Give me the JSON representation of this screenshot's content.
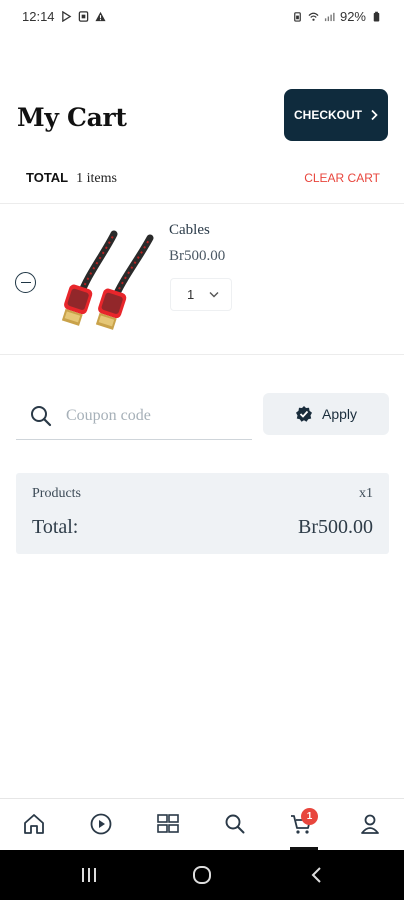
{
  "status_bar": {
    "time": "12:14",
    "battery": "92%"
  },
  "header": {
    "title": "My Cart",
    "checkout_label": "CHECKOUT"
  },
  "cart_summary_row": {
    "total_label": "TOTAL",
    "items_count": "1 items",
    "clear_label": "CLEAR CART"
  },
  "items": [
    {
      "name": "Cables",
      "price": "Br500.00",
      "quantity": "1"
    }
  ],
  "coupon": {
    "placeholder": "Coupon code",
    "value": "",
    "apply_label": "Apply"
  },
  "summary": {
    "products_label": "Products",
    "products_qty": "x1",
    "total_label": "Total:",
    "total_value": "Br500.00"
  },
  "bottom_nav": {
    "items": [
      "home-icon",
      "play-circle-icon",
      "grid-icon",
      "search-icon",
      "cart-icon",
      "profile-icon"
    ],
    "cart_badge": "1",
    "active": "cart"
  },
  "colors": {
    "primary": "#0f2b3d",
    "danger": "#e8463d",
    "panel": "#eff2f5"
  }
}
